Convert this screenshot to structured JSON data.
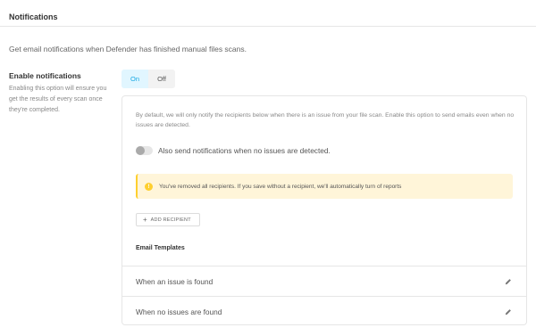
{
  "header": {
    "title": "Notifications"
  },
  "intro": "Get email notifications when Defender has finished manual files scans.",
  "enable": {
    "label": "Enable notifications",
    "description": "Enabling this option will ensure you get the results of every scan once they're completed.",
    "toggle": {
      "on_label": "On",
      "off_label": "Off",
      "selected": "On"
    }
  },
  "card": {
    "description": "By default, we will only notify the recipients below when there is an issue from your file scan. Enable this option to send emails even when no issues are detected.",
    "switch_label": "Also send notifications when no issues are detected.",
    "switch_enabled": false,
    "notice": {
      "icon": "warning-icon",
      "text": "You've removed all recipients. If you save without a recipient, we'll automatically turn of reports"
    },
    "add_recipient_label": "ADD RECIPIENT",
    "templates_heading": "Email Templates",
    "templates": [
      {
        "label": "When an issue is found",
        "icon": "pencil-icon"
      },
      {
        "label": "When no issues are found",
        "icon": "pencil-icon"
      }
    ]
  },
  "colors": {
    "accent": "#17a8e3",
    "toggle_on_bg": "#e1f6ff",
    "warning": "#fecf2f",
    "notice_bg": "#fff5d9"
  }
}
